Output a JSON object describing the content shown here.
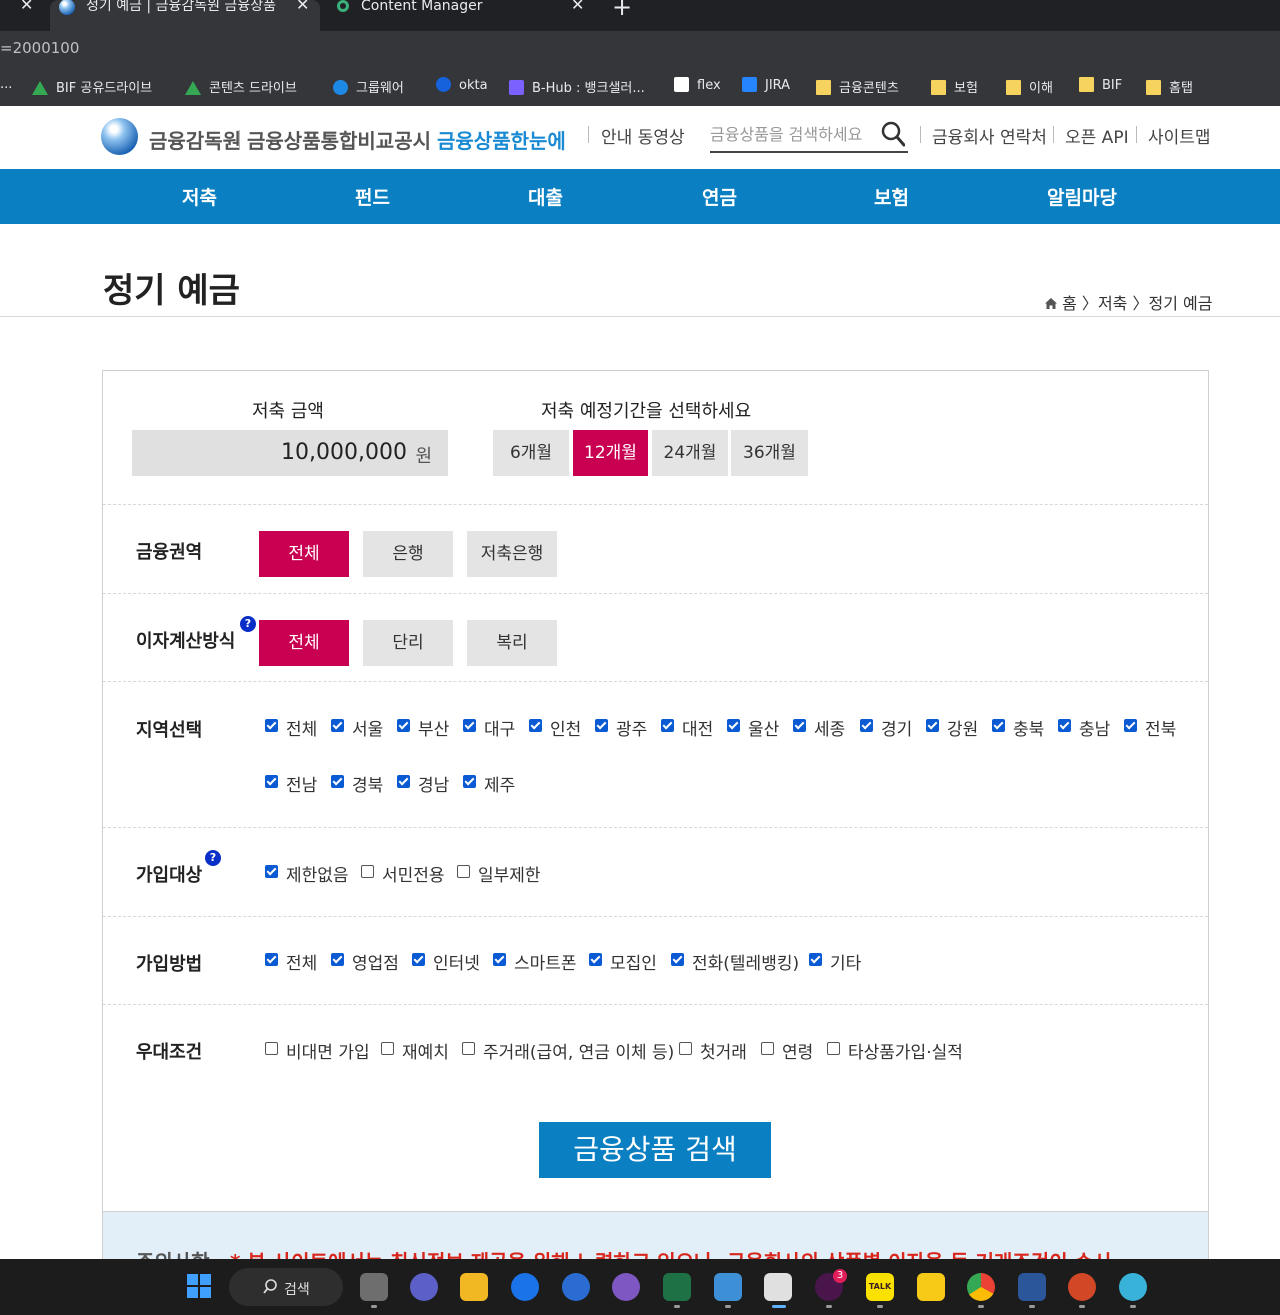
{
  "browser": {
    "tabs": [
      {
        "title": "",
        "close": "✕"
      },
      {
        "title": "정기 예금 | 금융감독원 금융상품",
        "close": "✕"
      },
      {
        "title": "Content Manager",
        "close": "✕"
      }
    ],
    "new_tab": "+",
    "address": "=2000100",
    "bookmarks": [
      {
        "label": "...",
        "icon": "folder-icon"
      },
      {
        "label": "BIF 공유드라이브",
        "icon": "google-drive-icon"
      },
      {
        "label": "콘텐츠 드라이브",
        "icon": "google-drive-icon"
      },
      {
        "label": "그룹웨어",
        "icon": "groupware-icon"
      },
      {
        "label": "okta",
        "icon": "okta-icon"
      },
      {
        "label": "B-Hub : 뱅크샐러...",
        "icon": "bhub-icon"
      },
      {
        "label": "flex",
        "icon": "flex-icon"
      },
      {
        "label": "JIRA",
        "icon": "jira-icon"
      },
      {
        "label": "금융콘텐츠",
        "icon": "folder-icon"
      },
      {
        "label": "보험",
        "icon": "folder-icon"
      },
      {
        "label": "이해",
        "icon": "folder-icon"
      },
      {
        "label": "BIF",
        "icon": "folder-icon"
      },
      {
        "label": "홈탭",
        "icon": "folder-icon"
      }
    ]
  },
  "header": {
    "logo_org": "금융감독원",
    "logo_service": "금융상품통합비교공시",
    "logo_brand": "금융상품한눈에",
    "guide_video": "안내 동영상",
    "search_placeholder": "금융상품을 검색하세요",
    "contacts": "금융회사 연락처",
    "open_api": "오픈 API",
    "sitemap": "사이트맵"
  },
  "nav": [
    "저축",
    "펀드",
    "대출",
    "연금",
    "보험",
    "알림마당"
  ],
  "page": {
    "title": "정기 예금",
    "breadcrumb": [
      "홈",
      "저축",
      "정기 예금"
    ]
  },
  "form": {
    "amount_label": "저축 금액",
    "amount_value": "10,000,000",
    "amount_unit": "원",
    "period_label": "저축 예정기간을 선택하세요",
    "periods": [
      {
        "label": "6개월",
        "selected": false
      },
      {
        "label": "12개월",
        "selected": true
      },
      {
        "label": "24개월",
        "selected": false
      },
      {
        "label": "36개월",
        "selected": false
      }
    ],
    "sector_label": "금융권역",
    "sectors": [
      {
        "label": "전체",
        "selected": true
      },
      {
        "label": "은행",
        "selected": false
      },
      {
        "label": "저축은행",
        "selected": false
      }
    ],
    "interest_label": "이자계산방식",
    "interest_options": [
      {
        "label": "전체",
        "selected": true
      },
      {
        "label": "단리",
        "selected": false
      },
      {
        "label": "복리",
        "selected": false
      }
    ],
    "region_label": "지역선택",
    "regions": [
      {
        "label": "전체",
        "checked": true
      },
      {
        "label": "서울",
        "checked": true
      },
      {
        "label": "부산",
        "checked": true
      },
      {
        "label": "대구",
        "checked": true
      },
      {
        "label": "인천",
        "checked": true
      },
      {
        "label": "광주",
        "checked": true
      },
      {
        "label": "대전",
        "checked": true
      },
      {
        "label": "울산",
        "checked": true
      },
      {
        "label": "세종",
        "checked": true
      },
      {
        "label": "경기",
        "checked": true
      },
      {
        "label": "강원",
        "checked": true
      },
      {
        "label": "충북",
        "checked": true
      },
      {
        "label": "충남",
        "checked": true
      },
      {
        "label": "전북",
        "checked": true
      },
      {
        "label": "전남",
        "checked": true
      },
      {
        "label": "경북",
        "checked": true
      },
      {
        "label": "경남",
        "checked": true
      },
      {
        "label": "제주",
        "checked": true
      }
    ],
    "target_label": "가입대상",
    "targets": [
      {
        "label": "제한없음",
        "checked": true
      },
      {
        "label": "서민전용",
        "checked": false
      },
      {
        "label": "일부제한",
        "checked": false
      }
    ],
    "method_label": "가입방법",
    "methods": [
      {
        "label": "전체",
        "checked": true
      },
      {
        "label": "영업점",
        "checked": true
      },
      {
        "label": "인터넷",
        "checked": true
      },
      {
        "label": "스마트폰",
        "checked": true
      },
      {
        "label": "모집인",
        "checked": true
      },
      {
        "label": "전화(텔레뱅킹)",
        "checked": true
      },
      {
        "label": "기타",
        "checked": true
      }
    ],
    "preference_label": "우대조건",
    "preferences": [
      {
        "label": "비대면 가입",
        "checked": false
      },
      {
        "label": "재예치",
        "checked": false
      },
      {
        "label": "주거래(급여, 연금 이체 등)",
        "checked": false
      },
      {
        "label": "첫거래",
        "checked": false
      },
      {
        "label": "연령",
        "checked": false
      },
      {
        "label": "타상품가입·실적",
        "checked": false
      }
    ],
    "help_mark": "?",
    "search_button": "금융상품 검색"
  },
  "notice": {
    "title": "주의사항",
    "text": "* 본 사이트에서는 최신정보 제공을 위해 노력하고 있으나, 금융회사의 상품별 이자율 등 거래조건이 수시"
  },
  "taskbar": {
    "search_label": "검색",
    "slack_badge": "3",
    "kakao_label": "TALK"
  },
  "colors": {
    "nav_blue": "#0a7fc1",
    "selected_magenta": "#c90052",
    "checkbox_blue": "#0a5bd3",
    "notice_red": "#d9261c"
  }
}
